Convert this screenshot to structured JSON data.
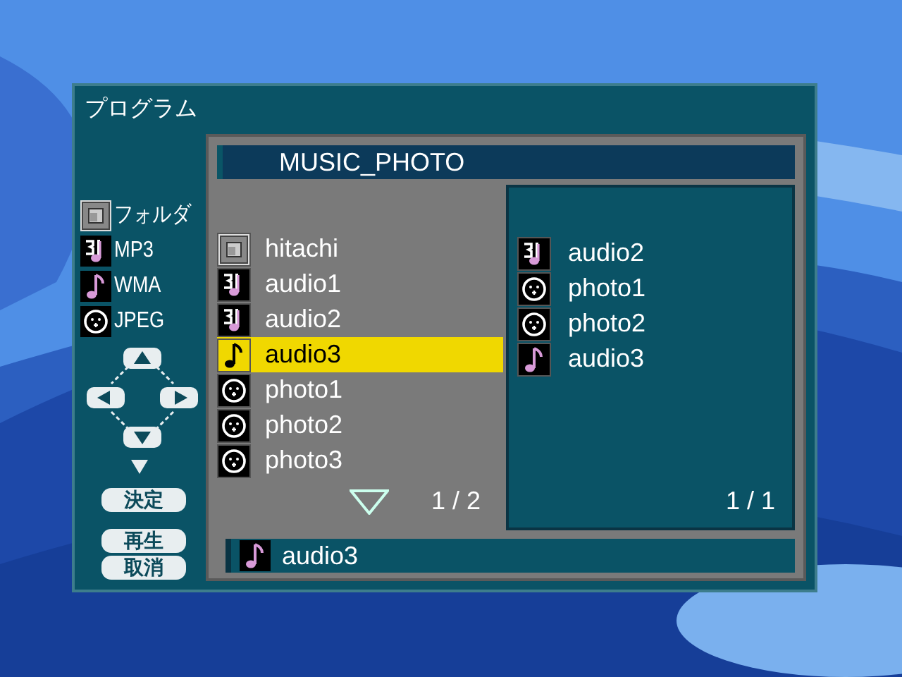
{
  "window": {
    "title": "プログラム"
  },
  "legend": [
    {
      "kind": "folder",
      "label": "フォルダ"
    },
    {
      "kind": "mp3",
      "label": "MP3"
    },
    {
      "kind": "wma",
      "label": "WMA"
    },
    {
      "kind": "jpeg",
      "label": "JPEG"
    }
  ],
  "buttons": [
    {
      "label": "決定"
    },
    {
      "label": "再生"
    },
    {
      "label": "取消"
    }
  ],
  "path": "MUSIC_PHOTO",
  "file_list": {
    "items": [
      {
        "kind": "folder",
        "name": "hitachi",
        "selected": false
      },
      {
        "kind": "mp3",
        "name": "audio1",
        "selected": false
      },
      {
        "kind": "mp3",
        "name": "audio2",
        "selected": false
      },
      {
        "kind": "wma",
        "name": "audio3",
        "selected": true
      },
      {
        "kind": "jpeg",
        "name": "photo1",
        "selected": false
      },
      {
        "kind": "jpeg",
        "name": "photo2",
        "selected": false
      },
      {
        "kind": "jpeg",
        "name": "photo3",
        "selected": false
      }
    ],
    "page": "1 / 2"
  },
  "program_list": {
    "items": [
      {
        "kind": "mp3",
        "name": "audio2"
      },
      {
        "kind": "jpeg",
        "name": "photo1"
      },
      {
        "kind": "jpeg",
        "name": "photo2"
      },
      {
        "kind": "wma",
        "name": "audio3"
      }
    ],
    "page": "1 / 1"
  },
  "current": {
    "kind": "wma",
    "name": "audio3"
  }
}
